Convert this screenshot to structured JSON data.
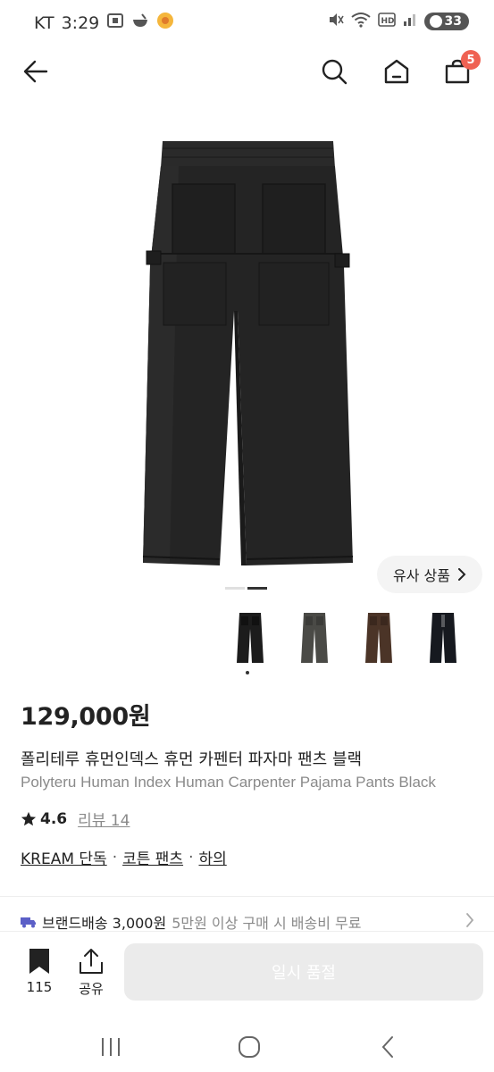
{
  "status_bar": {
    "carrier": "KT",
    "time": "3:29",
    "battery": "33"
  },
  "nav": {
    "cart_count": "5"
  },
  "product": {
    "similar_label": "유사 상품",
    "price": "129,000원",
    "name_ko": "폴리테루 휴먼인덱스 휴먼 카펜터 파자마 팬츠 블랙",
    "name_en": "Polyteru Human Index Human Carpenter Pajama Pants Black",
    "rating": "4.6",
    "review_label": "리뷰 14",
    "tags": [
      "KREAM 단독",
      "코튼 팬츠",
      "하의"
    ],
    "tag_separator": "·",
    "thumbnail_colors": [
      "#1c1c1c",
      "#4a4a46",
      "#4b3427",
      "#16191f"
    ]
  },
  "shipping": {
    "brand_delivery": "브랜드배송 3,000원",
    "note": "5만원 이상 구매 시 배송비 무료"
  },
  "action_bar": {
    "bookmark_count": "115",
    "share_label": "공유",
    "soldout_label": "일시 품절"
  },
  "colors": {
    "badge": "#ef6253",
    "disabled_button": "#ebebeb",
    "muted_text": "#8a8a8a",
    "shipping_truck": "#5b5fc7"
  }
}
